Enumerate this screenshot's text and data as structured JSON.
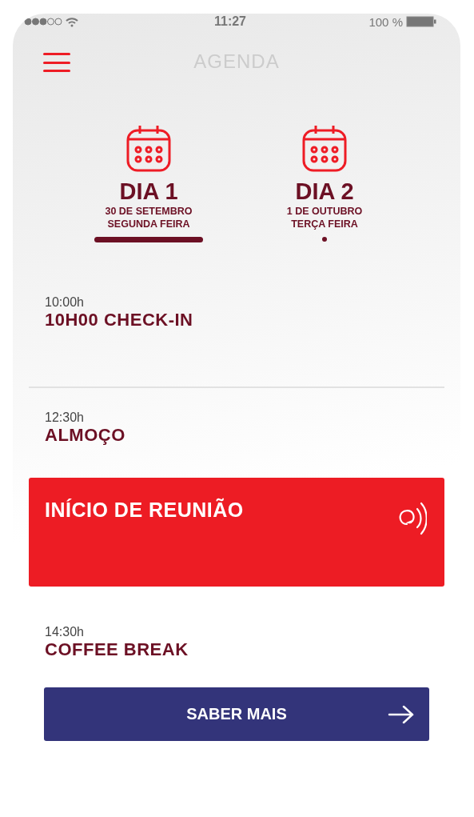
{
  "status_bar": {
    "time": "11:27",
    "battery": "100 %"
  },
  "header": {
    "title": "AGENDA"
  },
  "days": [
    {
      "label": "DIA 1",
      "date": "30 DE SETEMBRO",
      "weekday": "SEGUNDA FEIRA",
      "selected": true
    },
    {
      "label": "DIA 2",
      "date": "1 DE OUTUBRO",
      "weekday": "TERÇA FEIRA",
      "selected": false
    }
  ],
  "events": [
    {
      "kind": "plain",
      "time": "10:00h",
      "title": "10H00 CHECK-IN"
    },
    {
      "kind": "plain",
      "time": "12:30h",
      "title": "ALMOÇO"
    },
    {
      "kind": "live",
      "title": "INÍCIO DE REUNIÃO"
    },
    {
      "kind": "plain",
      "time": "14:30h",
      "title": "COFFEE BREAK",
      "button": "SABER MAIS"
    }
  ]
}
